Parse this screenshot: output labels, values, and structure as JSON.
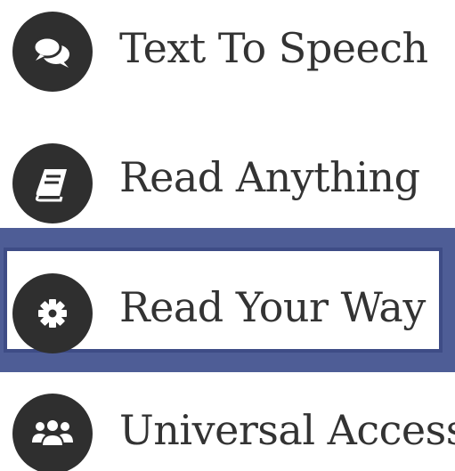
{
  "colors": {
    "icon_background": "#2f2f2f",
    "text": "#333333",
    "selection_frame": "#4e5d96",
    "selection_border": "#3e4c86",
    "background": "#ffffff"
  },
  "menu": {
    "items": [
      {
        "label": "Text To Speech",
        "icon": "speech-bubbles-icon",
        "selected": false
      },
      {
        "label": "Read Anything",
        "icon": "book-icon",
        "selected": false
      },
      {
        "label": "Read Your Way",
        "icon": "gear-icon",
        "selected": true
      },
      {
        "label": "Universal Access",
        "icon": "users-icon",
        "selected": false
      }
    ]
  }
}
